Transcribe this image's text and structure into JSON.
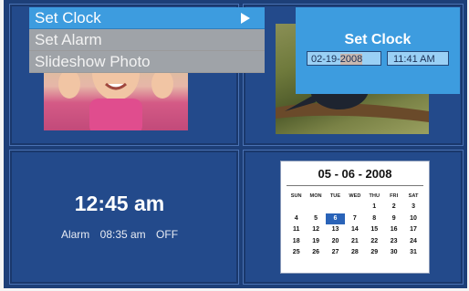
{
  "menu": {
    "items": [
      {
        "label": "Set Clock",
        "selected": true
      },
      {
        "label": "Set Alarm",
        "selected": false
      },
      {
        "label": "Slideshow Photo",
        "selected": false
      }
    ]
  },
  "set_clock": {
    "title": "Set Clock",
    "date_prefix": "02-19-",
    "date_year": "2008",
    "time": "11:41 AM"
  },
  "clock": {
    "time": "12:45 am",
    "alarm_label": "Alarm",
    "alarm_time": "08:35 am",
    "alarm_state": "OFF"
  },
  "calendar": {
    "date": "05 - 06 - 2008",
    "weekdays": [
      "SUN",
      "MON",
      "TUE",
      "WED",
      "THU",
      "FRI",
      "SAT"
    ],
    "weeks": [
      [
        "",
        "",
        "",
        "",
        "1",
        "2",
        "3"
      ],
      [
        "4",
        "5",
        "6",
        "7",
        "8",
        "9",
        "10"
      ],
      [
        "11",
        "12",
        "13",
        "14",
        "15",
        "16",
        "17"
      ],
      [
        "18",
        "19",
        "20",
        "21",
        "22",
        "23",
        "24"
      ],
      [
        "25",
        "26",
        "27",
        "28",
        "29",
        "30",
        "31"
      ]
    ],
    "today": "6"
  },
  "colors": {
    "screen_bg": "#1d3f78",
    "tile_bg": "#234a8b",
    "accent": "#3d9cdf",
    "menu_inactive": "#9fa3a8"
  },
  "icons": {
    "menu_arrow": "right-arrow-icon"
  }
}
